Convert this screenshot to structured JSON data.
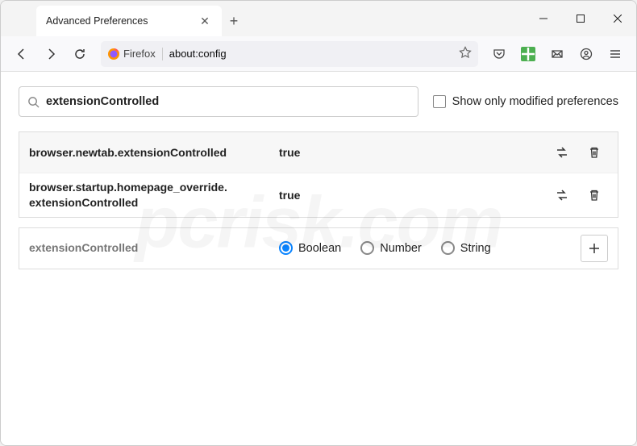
{
  "tab": {
    "title": "Advanced Preferences"
  },
  "urlbar": {
    "identity": "Firefox",
    "url": "about:config"
  },
  "search": {
    "value": "extensionControlled",
    "checkbox_label": "Show only modified preferences"
  },
  "prefs": [
    {
      "name": "browser.newtab.extensionControlled",
      "value": "true"
    },
    {
      "name": "browser.startup.homepage_override.extensionControlled",
      "value": "true"
    }
  ],
  "new_pref": {
    "name": "extensionControlled",
    "types": [
      "Boolean",
      "Number",
      "String"
    ],
    "selected": "Boolean"
  },
  "watermark": "pcrisk.com"
}
